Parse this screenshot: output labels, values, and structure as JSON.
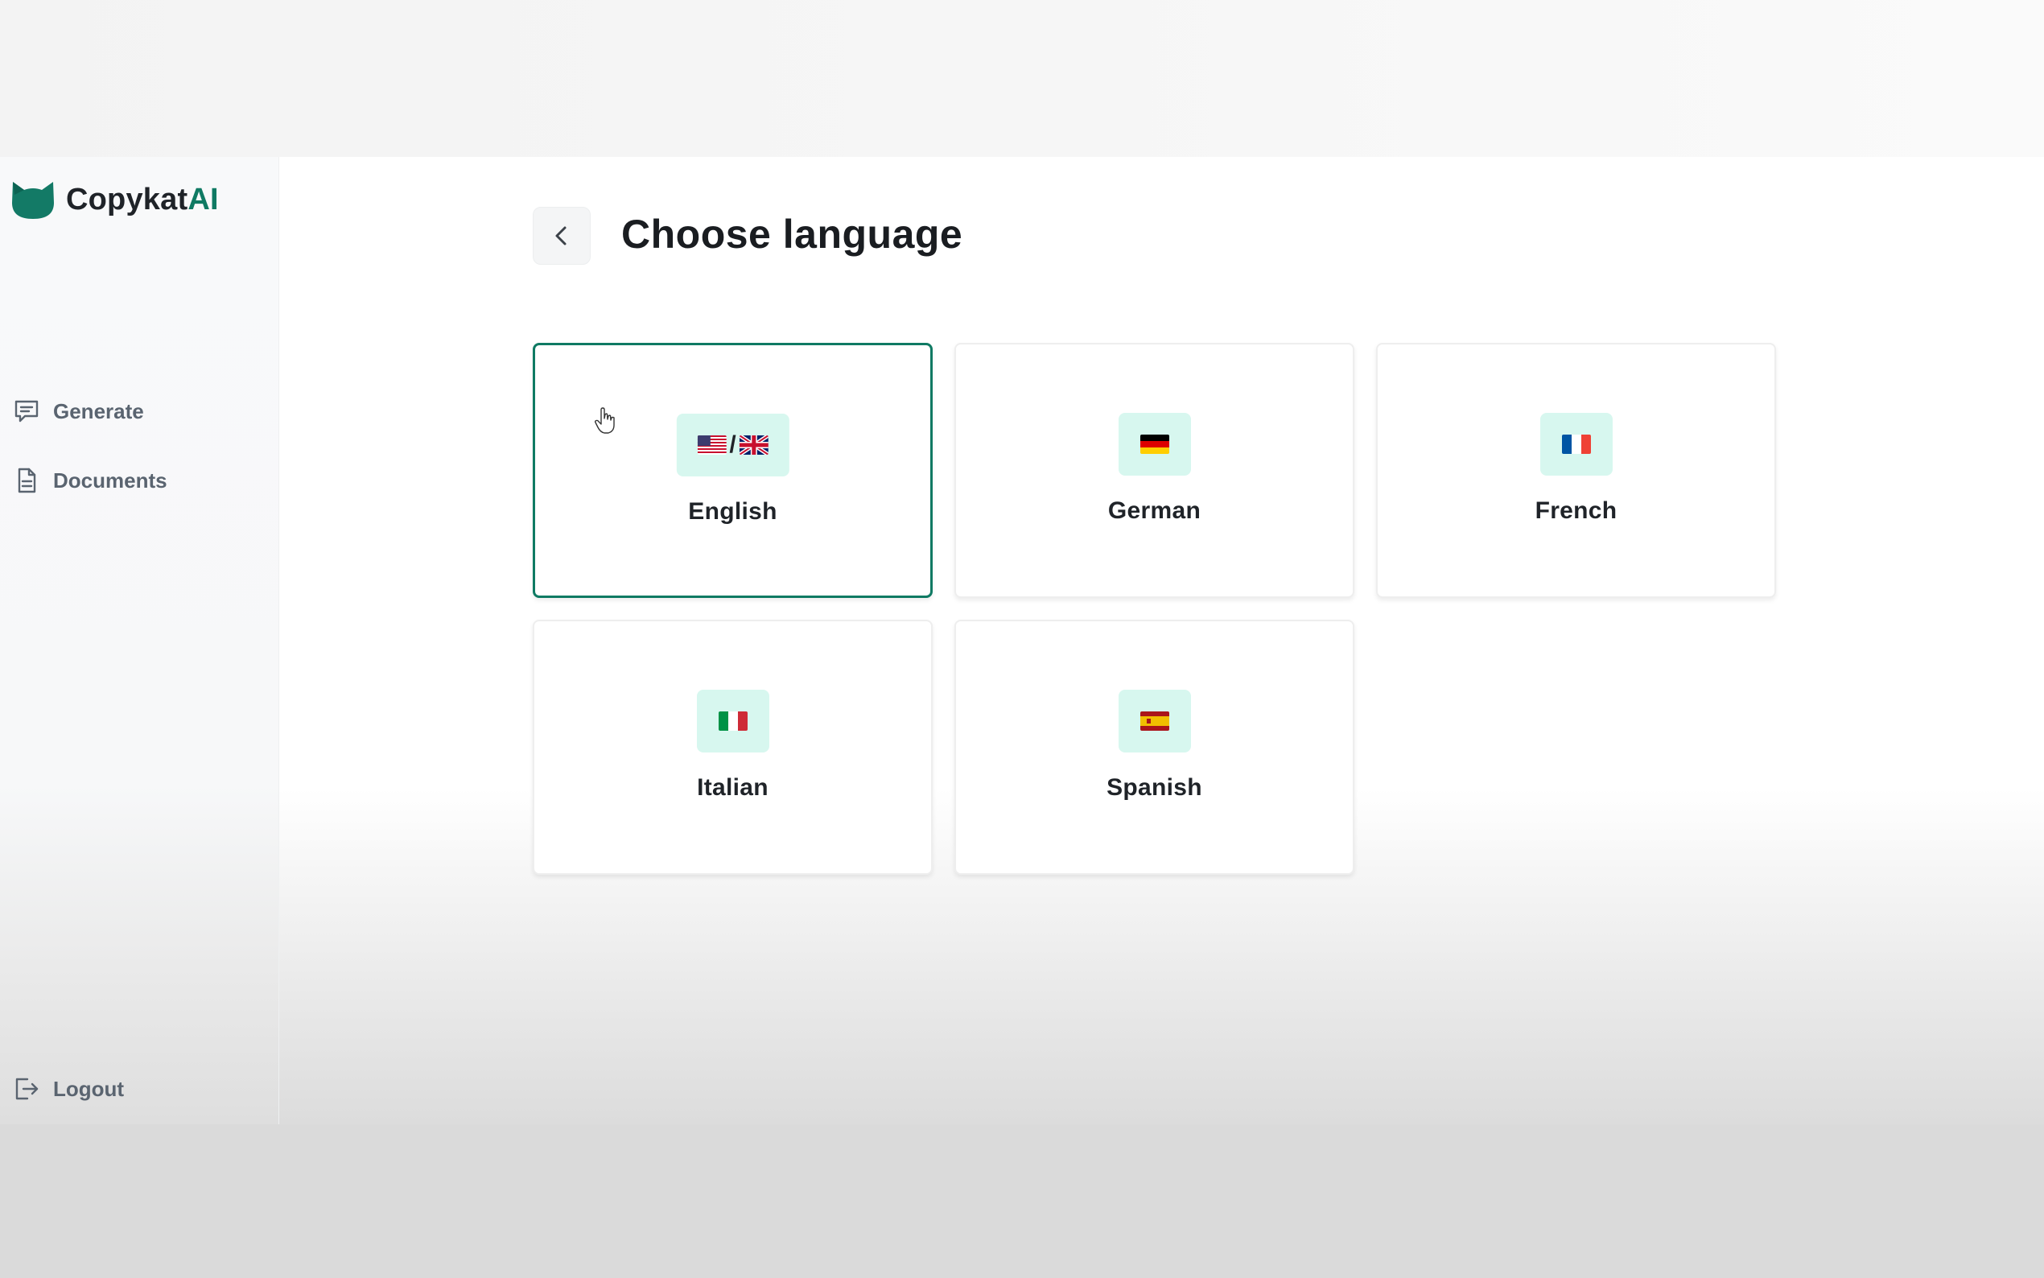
{
  "app": {
    "name_prefix": "Copykat",
    "name_suffix": "AI",
    "accent_color": "#0f7a63",
    "flag_bg_color": "#d7f7ef"
  },
  "sidebar": {
    "items": [
      {
        "label": "Generate",
        "icon": "chat-message-icon"
      },
      {
        "label": "Documents",
        "icon": "document-icon"
      }
    ],
    "logout": {
      "label": "Logout",
      "icon": "logout-icon"
    }
  },
  "header": {
    "back_icon": "chevron-left-icon",
    "title": "Choose language"
  },
  "languages": [
    {
      "label": "English",
      "flags": [
        "us-flag",
        "uk-flag"
      ],
      "selected": true
    },
    {
      "label": "German",
      "flags": [
        "germany-flag"
      ],
      "selected": false
    },
    {
      "label": "French",
      "flags": [
        "france-flag"
      ],
      "selected": false
    },
    {
      "label": "Italian",
      "flags": [
        "italy-flag"
      ],
      "selected": false
    },
    {
      "label": "Spanish",
      "flags": [
        "spain-flag"
      ],
      "selected": false
    }
  ],
  "flag_separator": "/"
}
